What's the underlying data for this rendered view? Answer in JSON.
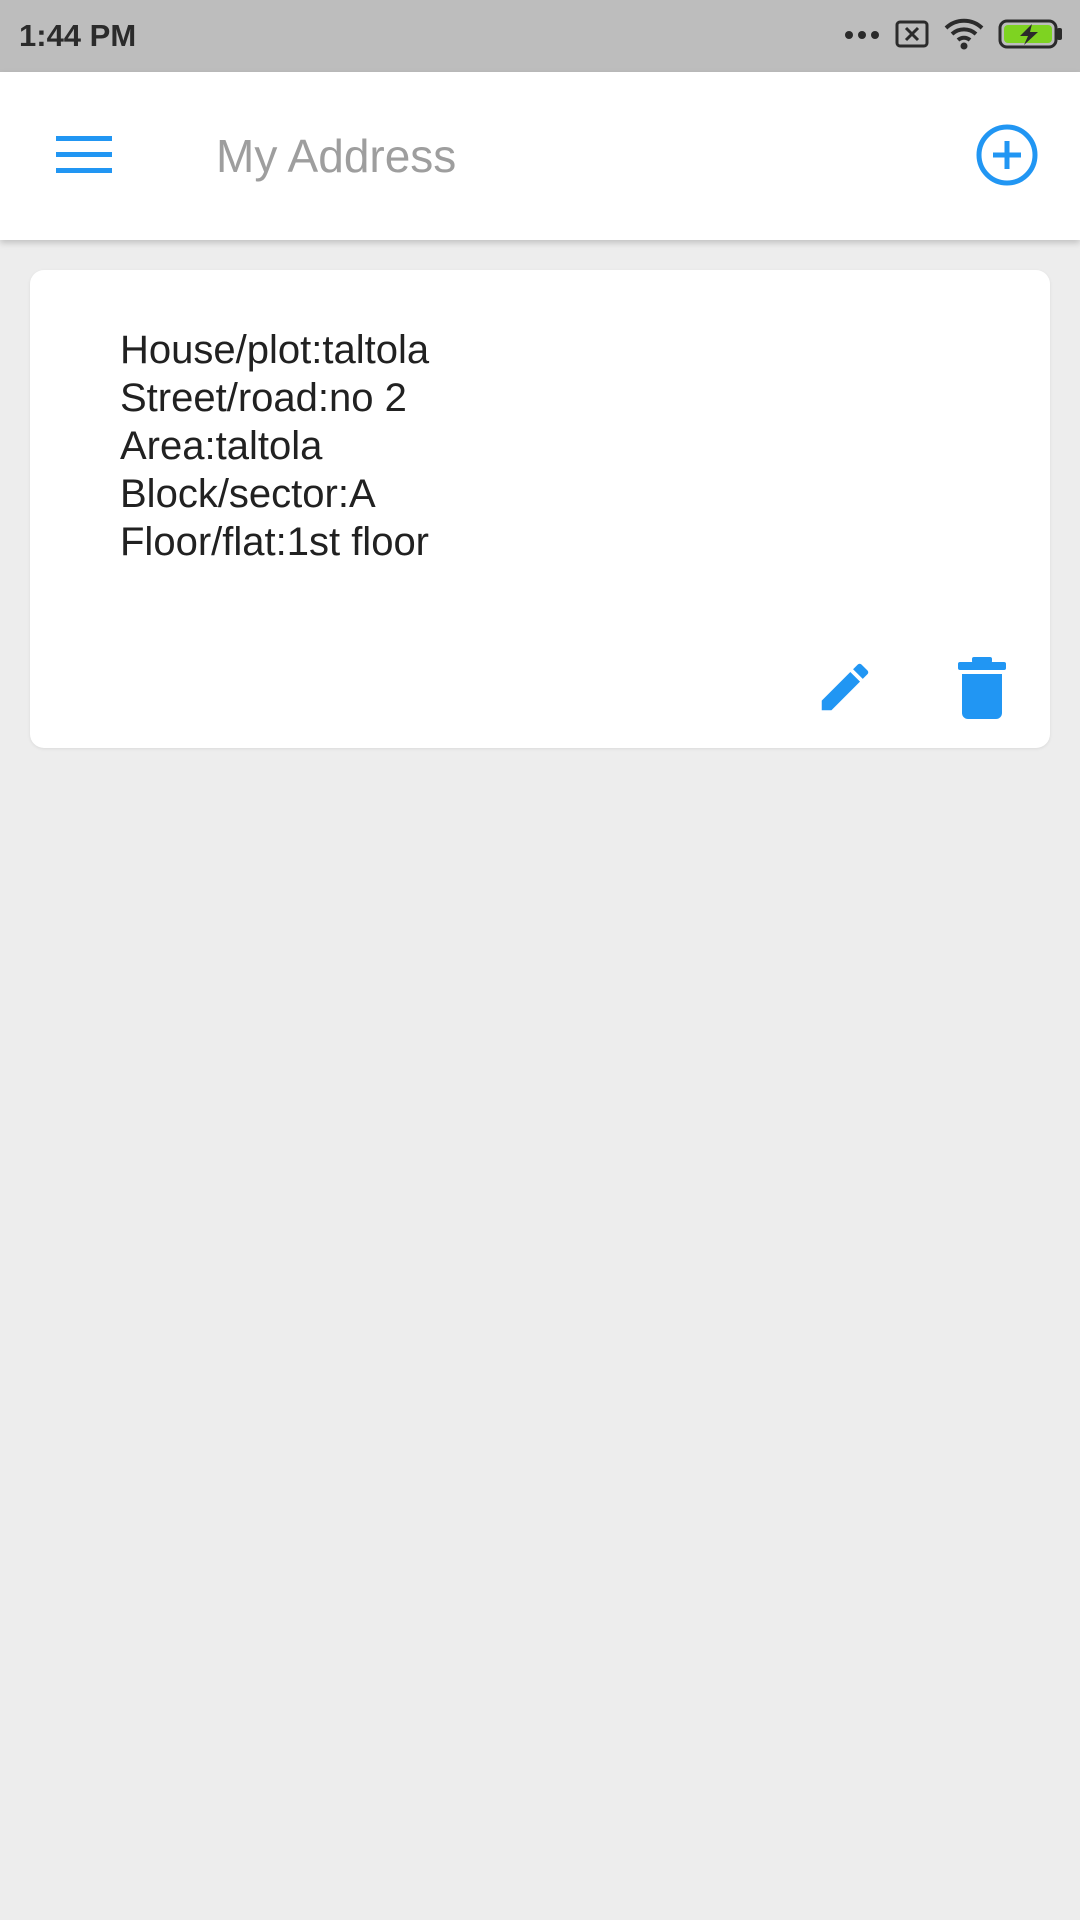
{
  "status_bar": {
    "time": "1:44 PM",
    "icons": [
      "more-dots-icon",
      "no-sim-icon",
      "wifi-icon",
      "battery-charging-icon"
    ]
  },
  "app_bar": {
    "menu_icon": "hamburger-menu-icon",
    "title": "My Address",
    "add_icon": "add-circle-icon"
  },
  "address_card": {
    "lines": [
      "House/plot:taltola",
      "Street/road:no 2",
      "Area:taltola",
      "Block/sector:A",
      "Floor/flat:1st floor"
    ],
    "edit_icon": "pencil-icon",
    "delete_icon": "trash-icon"
  },
  "colors": {
    "accent": "#2196f3",
    "status_bar": "#bdbdbd",
    "background": "#ededed",
    "title_text": "#9e9e9e",
    "body_text": "#212121",
    "battery_fill": "#7ed321"
  }
}
